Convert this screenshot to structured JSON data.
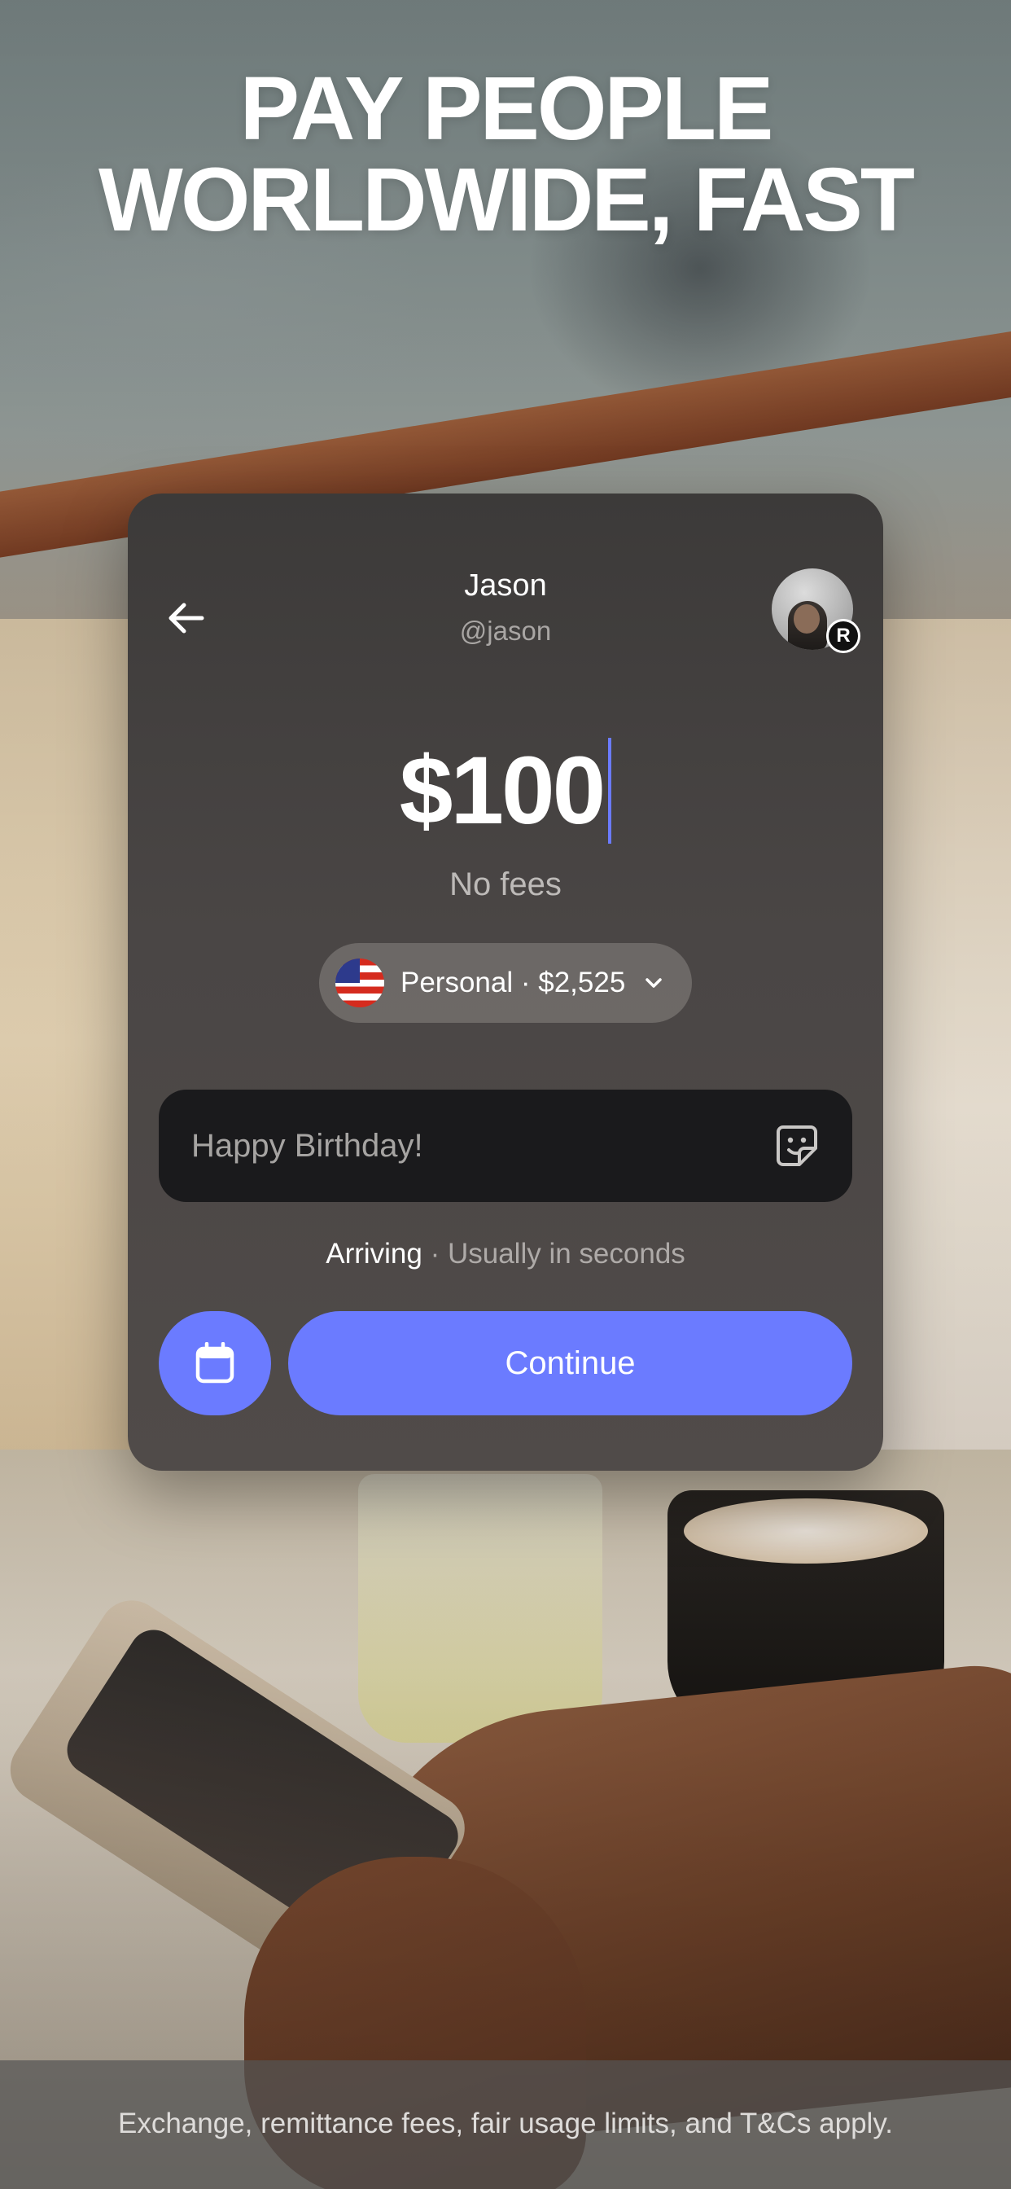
{
  "headline": {
    "line1": "PAY PEOPLE",
    "line2": "WORLDWIDE, FAST"
  },
  "recipient": {
    "name": "Jason",
    "handle": "@jason",
    "badge_letter": "R"
  },
  "amount": "$100",
  "fees_text": "No fees",
  "account": {
    "label": "Personal · $2,525",
    "flag": "us-flag-icon"
  },
  "note": {
    "placeholder": "Happy Birthday!"
  },
  "arrival": {
    "label": "Arriving",
    "separator": " · ",
    "detail": "Usually in seconds"
  },
  "actions": {
    "continue_label": "Continue"
  },
  "icons": {
    "back": "arrow-left-icon",
    "sticker": "sticker-icon",
    "calendar": "calendar-icon",
    "chevron": "chevron-down-icon"
  },
  "colors": {
    "accent": "#6b7bff",
    "card": "#4a4645",
    "note_field": "#1a1a1c"
  },
  "disclaimer": "Exchange, remittance fees, fair usage limits, and T&Cs apply."
}
